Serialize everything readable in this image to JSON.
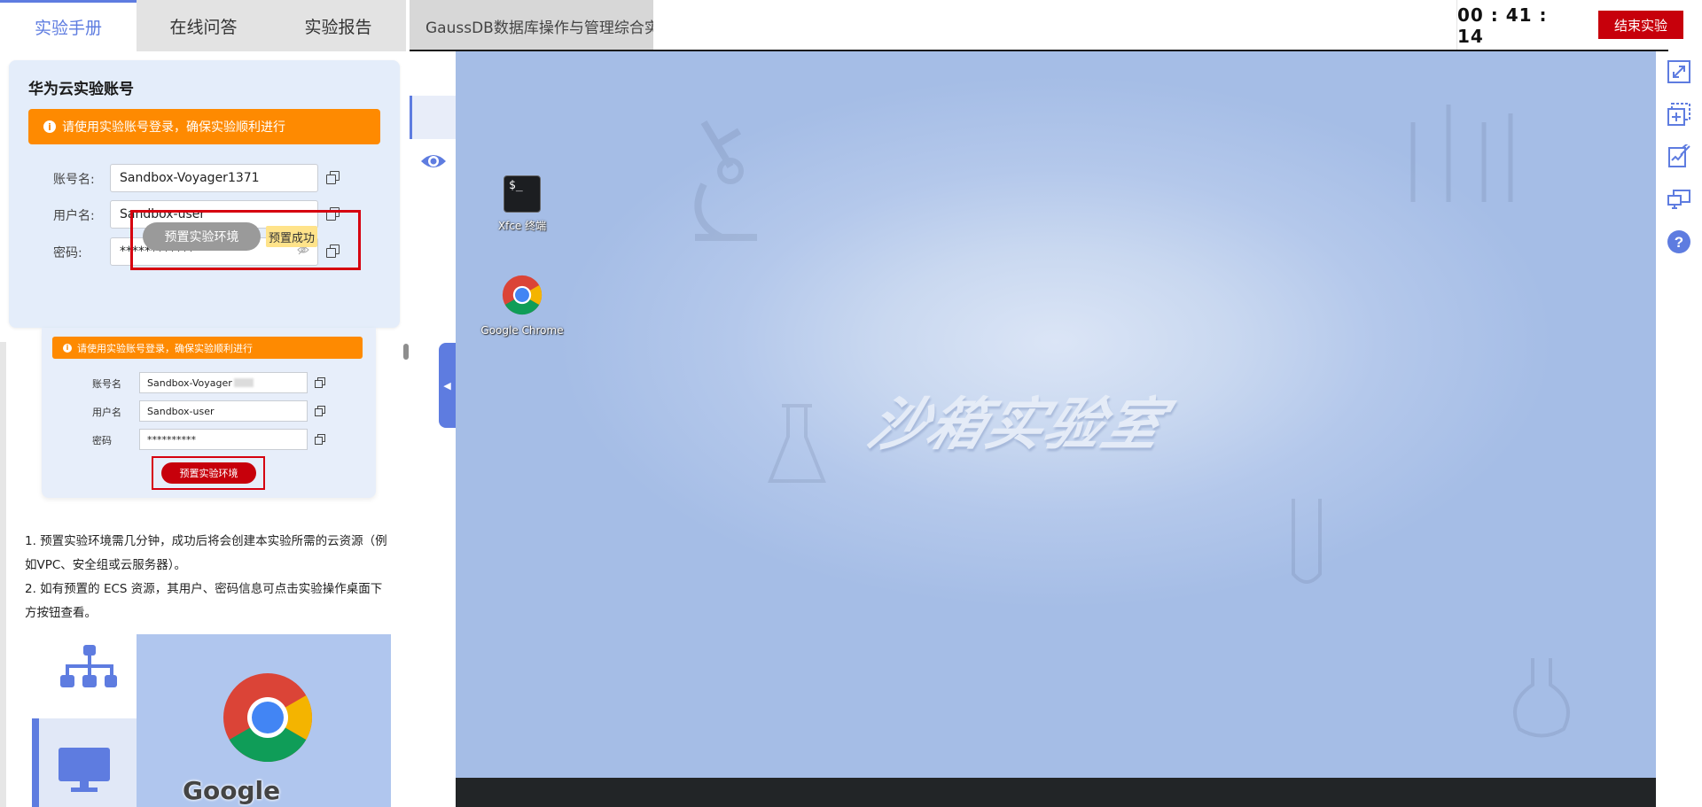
{
  "tabs": {
    "manual": "实验手册",
    "qa": "在线问答",
    "report": "实验报告"
  },
  "lab_title": "GaussDB数据库操作与管理综合实验",
  "timer": "00 : 41 : 14",
  "end_button": "结束实验",
  "account_card": {
    "title": "华为云实验账号",
    "banner": "请使用实验账号登录，确保实验顺利进行",
    "fields": [
      {
        "label": "账号名:",
        "value": "Sandbox-Voyager1371"
      },
      {
        "label": "用户名:",
        "value": "Sandbox-user"
      },
      {
        "label": "密码:",
        "value": "************"
      }
    ],
    "preset_button": "预置实验环境",
    "success_badge": "预置成功"
  },
  "example_card": {
    "banner": "请使用实验账号登录，确保实验顺利进行",
    "fields": [
      {
        "label": "账号名",
        "value": "Sandbox-Voyager"
      },
      {
        "label": "用户名",
        "value": "Sandbox-user"
      },
      {
        "label": "密码",
        "value": "**********"
      }
    ],
    "preset_button": "预置实验环境"
  },
  "notes": [
    "1. 预置实验环境需几分钟，成功后将会创建本实验所需的云资源（例如VPC、安全组或云服务器）。",
    "2. 如有预置的 ECS 资源，其用户、密码信息可点击实验操作桌面下方按钮查看。"
  ],
  "example_image2": {
    "label": "Google Chrome"
  },
  "desktop": {
    "icons": [
      {
        "label": "Xfce 终端",
        "icon": "terminal-icon"
      },
      {
        "label": "Google Chrome",
        "icon": "chrome-icon"
      }
    ],
    "watermark": "沙箱实验室"
  },
  "colors": {
    "accent": "#5e7ce0",
    "end_button": "#c7000b",
    "warning": "#fe8a01",
    "success_badge": "#ffe38a"
  },
  "right_tools": [
    "fullscreen-icon",
    "add-screen-icon",
    "notes-icon",
    "remote-desktop-icon",
    "help-icon"
  ]
}
